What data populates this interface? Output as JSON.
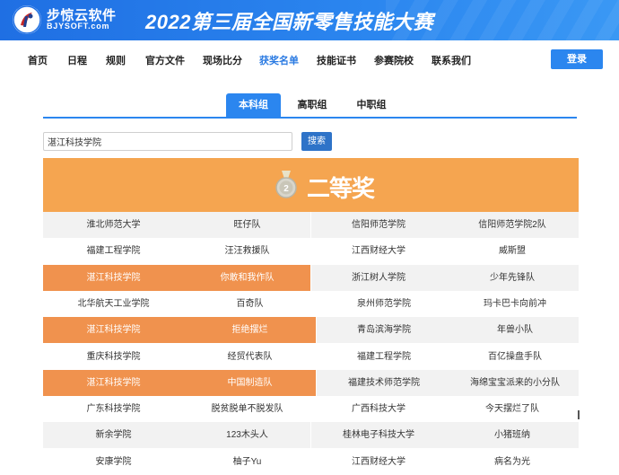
{
  "header": {
    "brand_cn": "步惊云软件",
    "brand_en": "BJYSOFT.com",
    "event_title": "2022第三届全国新零售技能大赛"
  },
  "nav": {
    "items": [
      {
        "label": "首页",
        "active": false
      },
      {
        "label": "日程",
        "active": false
      },
      {
        "label": "规则",
        "active": false
      },
      {
        "label": "官方文件",
        "active": false
      },
      {
        "label": "现场比分",
        "active": false
      },
      {
        "label": "获奖名单",
        "active": true
      },
      {
        "label": "技能证书",
        "active": false
      },
      {
        "label": "参赛院校",
        "active": false
      },
      {
        "label": "联系我们",
        "active": false
      }
    ],
    "login_label": "登录"
  },
  "tabs": [
    {
      "label": "本科组",
      "active": true
    },
    {
      "label": "高职组",
      "active": false
    },
    {
      "label": "中职组",
      "active": false
    }
  ],
  "search": {
    "value": "湛江科技学院",
    "button_label": "搜索"
  },
  "award": {
    "title": "二等奖",
    "medal_number": "2"
  },
  "rows": [
    {
      "left": [
        "淮北师范大学",
        "旺仔队"
      ],
      "right": [
        "信阳师范学院",
        "信阳师范学院2队"
      ],
      "left_hl": false,
      "right_hl": false
    },
    {
      "left": [
        "福建工程学院",
        "汪汪救援队"
      ],
      "right": [
        "江西财经大学",
        "威斯盟"
      ],
      "left_hl": false,
      "right_hl": false
    },
    {
      "left": [
        "湛江科技学院",
        "你敢和我作队"
      ],
      "right": [
        "浙江树人学院",
        "少年先锋队"
      ],
      "left_hl": true,
      "right_hl": false
    },
    {
      "left": [
        "北华航天工业学院",
        "百奇队"
      ],
      "right": [
        "泉州师范学院",
        "玛卡巴卡向前冲"
      ],
      "left_hl": false,
      "right_hl": false
    },
    {
      "left": [
        "湛江科技学院",
        "拒绝摆烂"
      ],
      "right": [
        "青岛滨海学院",
        "年兽小队"
      ],
      "left_hl": true,
      "right_hl": false
    },
    {
      "left": [
        "重庆科技学院",
        "经贸代表队"
      ],
      "right": [
        "福建工程学院",
        "百亿操盘手队"
      ],
      "left_hl": false,
      "right_hl": false
    },
    {
      "left": [
        "湛江科技学院",
        "中国制造队"
      ],
      "right": [
        "福建技术师范学院",
        "海绵宝宝派来的小分队"
      ],
      "left_hl": true,
      "right_hl": false
    },
    {
      "left": [
        "广东科技学院",
        "脱贫脱单不脱发队"
      ],
      "right": [
        "广西科技大学",
        "今天摆烂了队"
      ],
      "left_hl": false,
      "right_hl": false
    },
    {
      "left": [
        "新余学院",
        "123木头人"
      ],
      "right": [
        "桂林电子科技大学",
        "小猪班纳"
      ],
      "left_hl": false,
      "right_hl": false
    },
    {
      "left": [
        "安康学院",
        "柚子Yu"
      ],
      "right": [
        "江西财经大学",
        "病名为光"
      ],
      "left_hl": false,
      "right_hl": false
    }
  ]
}
